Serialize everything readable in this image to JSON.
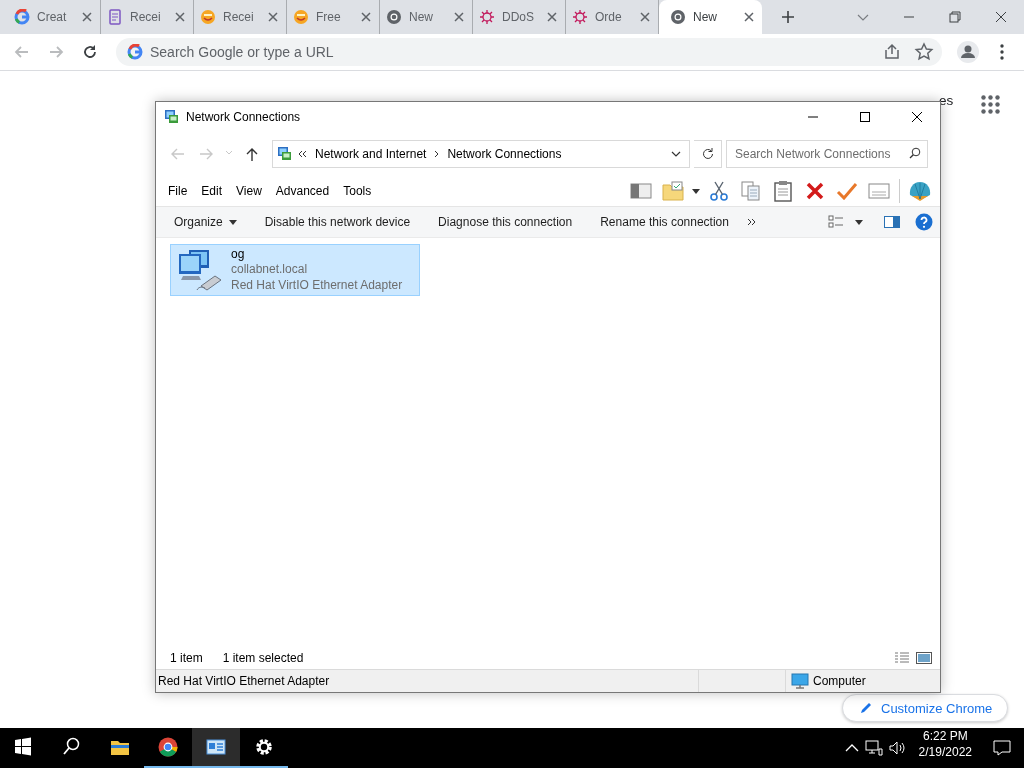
{
  "browser": {
    "tabs": [
      {
        "title": "Creat",
        "kind": "google",
        "selected": false
      },
      {
        "title": "Recei",
        "kind": "form",
        "selected": false
      },
      {
        "title": "Recei",
        "kind": "smiley",
        "selected": false
      },
      {
        "title": "Free",
        "kind": "smiley",
        "selected": false
      },
      {
        "title": "New",
        "kind": "chrome",
        "selected": false
      },
      {
        "title": "DDoS",
        "kind": "virus",
        "selected": false
      },
      {
        "title": "Orde",
        "kind": "virus",
        "selected": false
      },
      {
        "title": "New",
        "kind": "chrome",
        "selected": true
      }
    ],
    "omnibox": {
      "placeholder": "Search Google or type a URL"
    }
  },
  "new_tab_page": {
    "top_link": "es",
    "customize_button": "Customize Chrome"
  },
  "window": {
    "title": "Network Connections",
    "breadcrumbs": [
      "Network and Internet",
      "Network Connections"
    ],
    "search": {
      "placeholder": "Search Network Connections"
    },
    "menu": [
      "File",
      "Edit",
      "View",
      "Advanced",
      "Tools"
    ],
    "commands": [
      {
        "label": "Organize",
        "dropdown": true
      },
      {
        "label": "Disable this network device",
        "dropdown": false
      },
      {
        "label": "Diagnose this connection",
        "dropdown": false
      },
      {
        "label": "Rename this connection",
        "dropdown": false
      }
    ],
    "items": [
      {
        "name": "og",
        "domain": "collabnet.local",
        "adapter": "Red Hat VirtIO Ethernet Adapter",
        "selected": true
      }
    ],
    "status": {
      "count": "1 item",
      "selection": "1 item selected"
    },
    "status_bar": {
      "description": "Red Hat VirtIO Ethernet Adapter",
      "zone": "Computer"
    }
  },
  "taskbar": {
    "apps": [
      {
        "kind": "start",
        "running": false,
        "active": false
      },
      {
        "kind": "search",
        "running": false,
        "active": false
      },
      {
        "kind": "explorer",
        "running": false,
        "active": false
      },
      {
        "kind": "chrome",
        "running": true,
        "active": false
      },
      {
        "kind": "network",
        "running": true,
        "active": true
      },
      {
        "kind": "settings",
        "running": true,
        "active": false
      }
    ],
    "time": "6:22 PM",
    "date": "2/19/2022"
  }
}
